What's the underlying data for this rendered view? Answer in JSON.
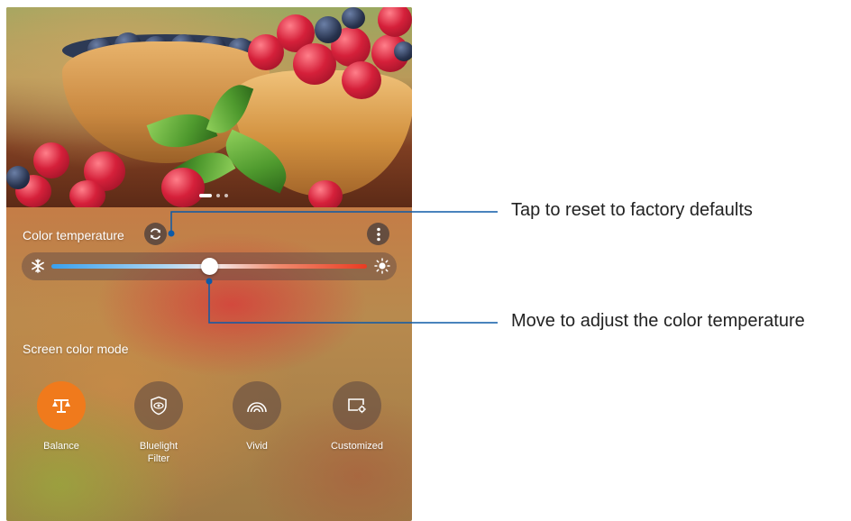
{
  "color_temperature": {
    "label": "Color temperature",
    "value": 0.5
  },
  "screen_color_mode": {
    "label": "Screen color mode",
    "modes": [
      {
        "label": "Balance",
        "icon": "balance-scale-icon",
        "selected": true
      },
      {
        "label": "Bluelight\nFilter",
        "icon": "eye-shield-icon",
        "selected": false
      },
      {
        "label": "Vivid",
        "icon": "rainbow-icon",
        "selected": false
      },
      {
        "label": "Customized",
        "icon": "screen-settings-icon",
        "selected": false
      }
    ]
  },
  "callouts": {
    "reset": "Tap to reset to factory defaults",
    "slider": "Move to adjust the color temperature"
  },
  "colors": {
    "accent": "#f07a1c",
    "callout_line": "#0d5aa7"
  }
}
